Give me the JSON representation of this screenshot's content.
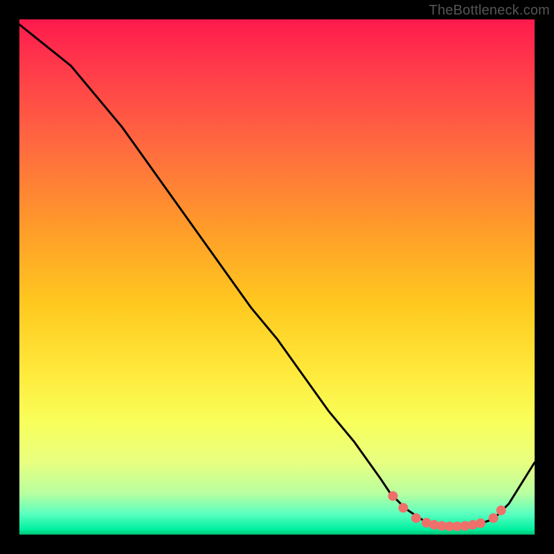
{
  "watermark": "TheBottleneck.com",
  "chart_data": {
    "type": "line",
    "title": "",
    "xlabel": "",
    "ylabel": "",
    "xlim": [
      0,
      100
    ],
    "ylim": [
      0,
      100
    ],
    "series": [
      {
        "name": "curve",
        "x": [
          0,
          5,
          10,
          15,
          20,
          25,
          30,
          35,
          40,
          45,
          50,
          55,
          60,
          65,
          70,
          72,
          75,
          78,
          80,
          83,
          86,
          89,
          92,
          95,
          100
        ],
        "y": [
          99,
          95,
          91,
          85,
          79,
          72,
          65,
          58,
          51,
          44,
          38,
          31,
          24,
          18,
          11,
          8,
          5,
          3,
          2,
          1.5,
          1.5,
          2,
          3,
          6,
          14
        ]
      }
    ],
    "markers": {
      "name": "highlight-dots",
      "x": [
        72.5,
        74.5,
        77,
        79,
        80.5,
        82,
        83.5,
        85,
        86.5,
        88,
        89.5,
        92,
        93.5
      ],
      "y": [
        7.5,
        5.2,
        3.2,
        2.3,
        1.9,
        1.7,
        1.6,
        1.6,
        1.7,
        1.9,
        2.2,
        3.2,
        4.7
      ]
    },
    "background": {
      "gradient": "vertical",
      "stops": [
        {
          "pos": 0.0,
          "color": "#ff1a4d"
        },
        {
          "pos": 0.25,
          "color": "#ff6b3f"
        },
        {
          "pos": 0.55,
          "color": "#ffc81f"
        },
        {
          "pos": 0.78,
          "color": "#f8ff5a"
        },
        {
          "pos": 0.92,
          "color": "#b8ffa0"
        },
        {
          "pos": 1.0,
          "color": "#00c070"
        }
      ]
    }
  }
}
